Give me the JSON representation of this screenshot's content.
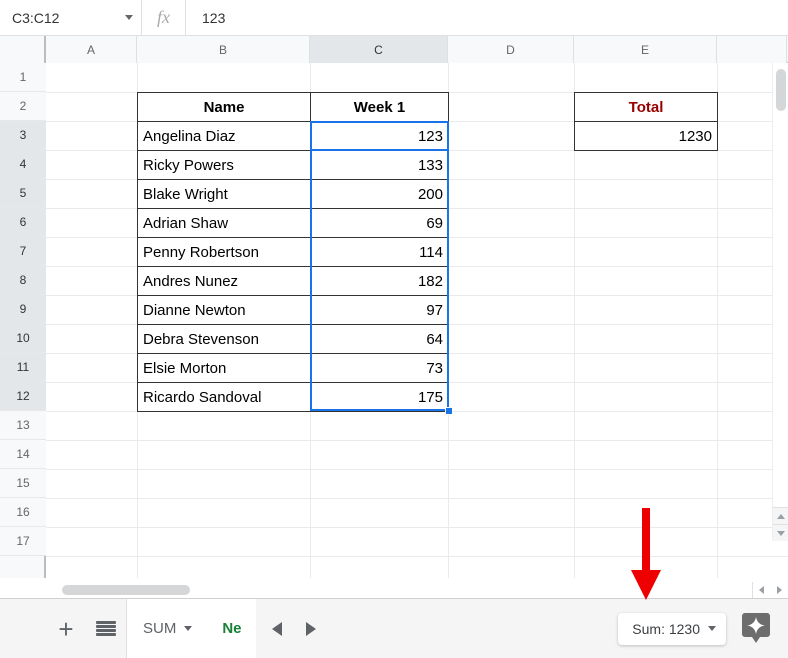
{
  "formula_bar": {
    "name_box_value": "C3:C12",
    "fx_label": "fx",
    "cell_value": "123"
  },
  "grid": {
    "column_headers": [
      "A",
      "B",
      "C",
      "D",
      "E"
    ],
    "selected_column": "C",
    "row_headers": [
      "1",
      "2",
      "3",
      "4",
      "5",
      "6",
      "7",
      "8",
      "9",
      "10",
      "11",
      "12",
      "13",
      "14",
      "15",
      "16",
      "17"
    ],
    "selected_rows": [
      "3",
      "4",
      "5",
      "6",
      "7",
      "8",
      "9",
      "10",
      "11",
      "12"
    ]
  },
  "table": {
    "headers": [
      "Name",
      "Week 1"
    ],
    "rows": [
      {
        "name": "Angelina Diaz",
        "value": "123"
      },
      {
        "name": "Ricky Powers",
        "value": "133"
      },
      {
        "name": "Blake Wright",
        "value": "200"
      },
      {
        "name": "Adrian Shaw",
        "value": "69"
      },
      {
        "name": "Penny Robertson",
        "value": "114"
      },
      {
        "name": "Andres Nunez",
        "value": "182"
      },
      {
        "name": "Dianne Newton",
        "value": "97"
      },
      {
        "name": "Debra Stevenson",
        "value": "64"
      },
      {
        "name": "Elsie Morton",
        "value": "73"
      },
      {
        "name": "Ricardo Sandoval",
        "value": "175"
      }
    ],
    "header_fill": "#d9ead3",
    "header_text_color": "#274e13",
    "selection_fill": "#e8f0fe",
    "selection_border": "#1a73e8"
  },
  "total_box": {
    "header": "Total",
    "value": "1230",
    "header_fill": "#f4cccc",
    "header_text_color": "#990000"
  },
  "annotation": {
    "arrow_color": "#ee0000",
    "points_to": "Sum: 1230"
  },
  "bottom_bar": {
    "add_sheet_label": "+",
    "all_sheets_label": "all-sheets",
    "tabs": [
      {
        "label": "SUM",
        "active": true,
        "has_caret": true
      },
      {
        "label": "Ne",
        "active": false,
        "has_caret": false
      }
    ],
    "prev_arrow": "◀",
    "next_arrow": "▶",
    "sum_chip_label": "Sum: 1230",
    "explore_label": "Explore"
  },
  "chart_data": {
    "type": "table",
    "title": "Week 1",
    "categories": [
      "Angelina Diaz",
      "Ricky Powers",
      "Blake Wright",
      "Adrian Shaw",
      "Penny Robertson",
      "Andres Nunez",
      "Dianne Newton",
      "Debra Stevenson",
      "Elsie Morton",
      "Ricardo Sandoval"
    ],
    "values": [
      123,
      133,
      200,
      69,
      114,
      182,
      97,
      64,
      73,
      175
    ],
    "total": 1230,
    "xlabel": "Name",
    "ylabel": "Week 1"
  }
}
